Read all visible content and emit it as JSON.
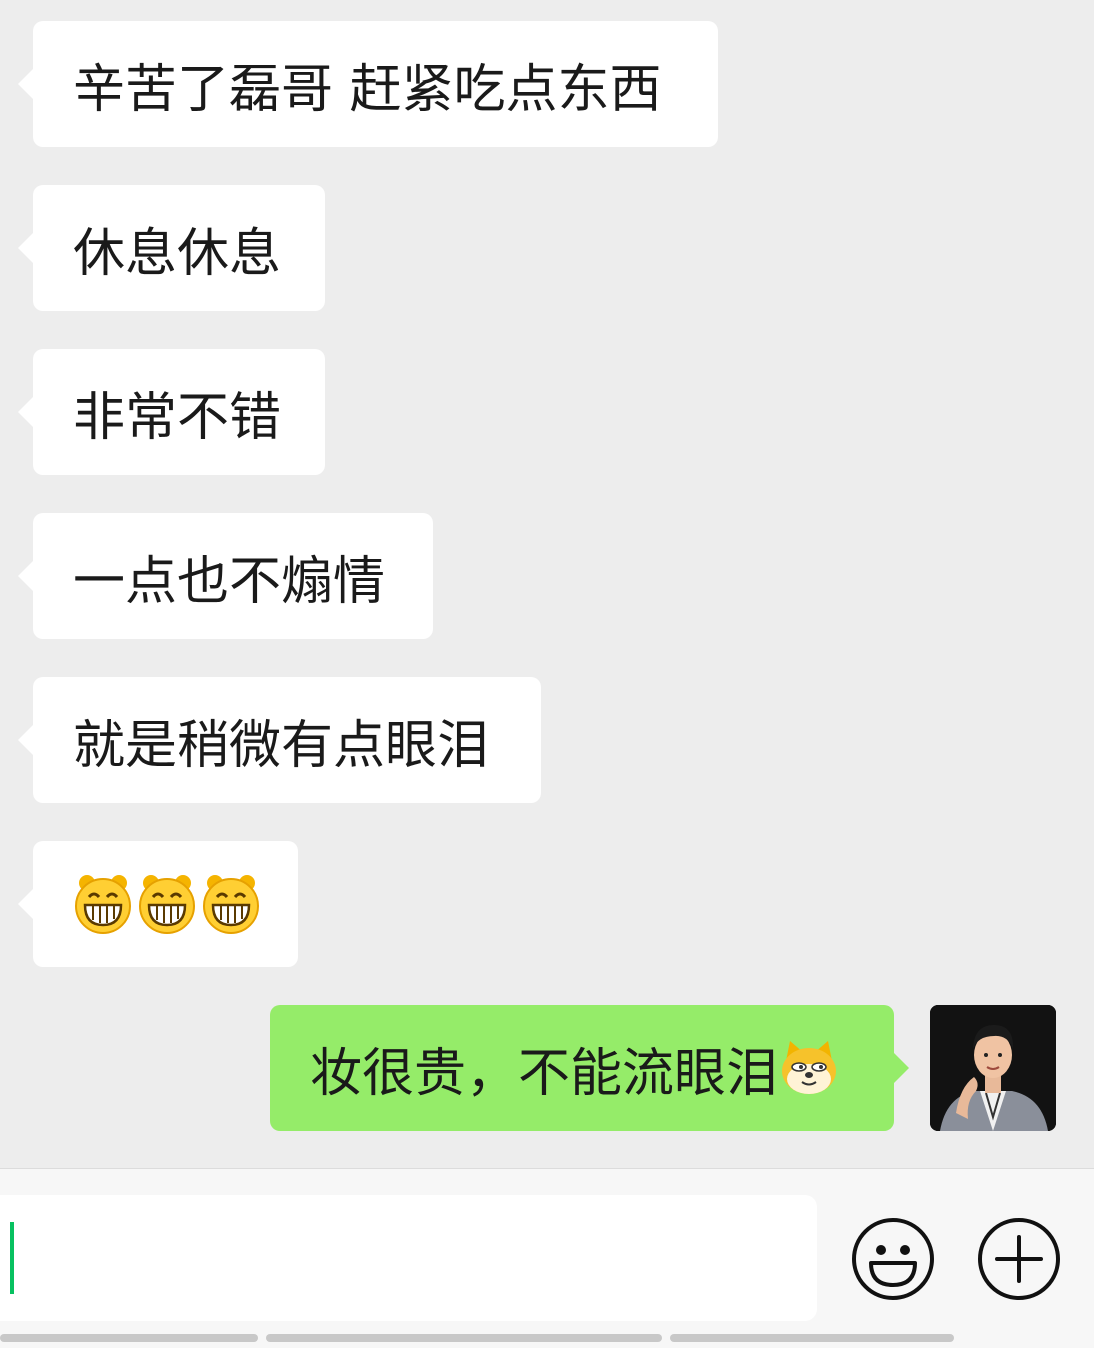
{
  "messages": [
    {
      "direction": "incoming",
      "text": "辛苦了磊哥 赶紧吃点东西"
    },
    {
      "direction": "incoming",
      "text": "休息休息"
    },
    {
      "direction": "incoming",
      "text": "非常不错"
    },
    {
      "direction": "incoming",
      "text": "一点也不煽情"
    },
    {
      "direction": "incoming",
      "text": "就是稍微有点眼泪"
    },
    {
      "direction": "incoming",
      "text": "",
      "emojis": [
        "grin-emoji",
        "grin-emoji",
        "grin-emoji"
      ]
    },
    {
      "direction": "outgoing",
      "text": "妆很贵，不能流眼泪",
      "emojis": [
        "doge-emoji"
      ]
    }
  ],
  "input": {
    "value": ""
  },
  "icons": {
    "emoji_button": "smiley-icon",
    "more_button": "plus-icon"
  },
  "colors": {
    "chat_background": "#ededed",
    "incoming_bubble": "#ffffff",
    "outgoing_bubble": "#95ec69",
    "cursor": "#07c160"
  }
}
